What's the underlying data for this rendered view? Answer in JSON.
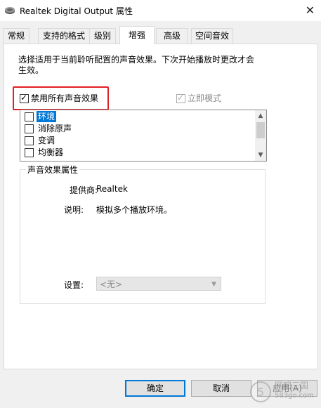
{
  "window": {
    "title": "Realtek Digital Output 属性",
    "close_glyph": "✕"
  },
  "tabs": [
    {
      "label": "常规"
    },
    {
      "label": "支持的格式"
    },
    {
      "label": "级别"
    },
    {
      "label": "增强"
    },
    {
      "label": "高级"
    },
    {
      "label": "空间音效"
    }
  ],
  "enhance": {
    "description": "选择适用于当前聆听配置的声音效果。下次开始播放时更改才会生效。",
    "disable_all_label": "禁用所有声音效果",
    "disable_all_checked": true,
    "immediate_mode_label": "立即模式",
    "immediate_mode_checked": true,
    "effects": [
      {
        "label": "环境",
        "checked": false,
        "selected": true
      },
      {
        "label": "消除原声",
        "checked": false,
        "selected": false
      },
      {
        "label": "变调",
        "checked": false,
        "selected": false
      },
      {
        "label": "均衡器",
        "checked": false,
        "selected": false
      }
    ],
    "properties": {
      "title": "声音效果属性",
      "provider_label": "提供商:",
      "provider_value": "Realtek",
      "explain_label": "说明:",
      "explain_value": "模拟多个播放环境。",
      "setting_label": "设置:",
      "setting_value": "<无>"
    }
  },
  "buttons": {
    "ok": "确定",
    "cancel": "取消",
    "apply": "应用(A)"
  },
  "watermark": {
    "text": "网吧三国",
    "url": "583go.com"
  },
  "colors": {
    "highlight_box": "#e31e24",
    "selection": "#0078d7",
    "default_button_border": "#0078d7"
  }
}
